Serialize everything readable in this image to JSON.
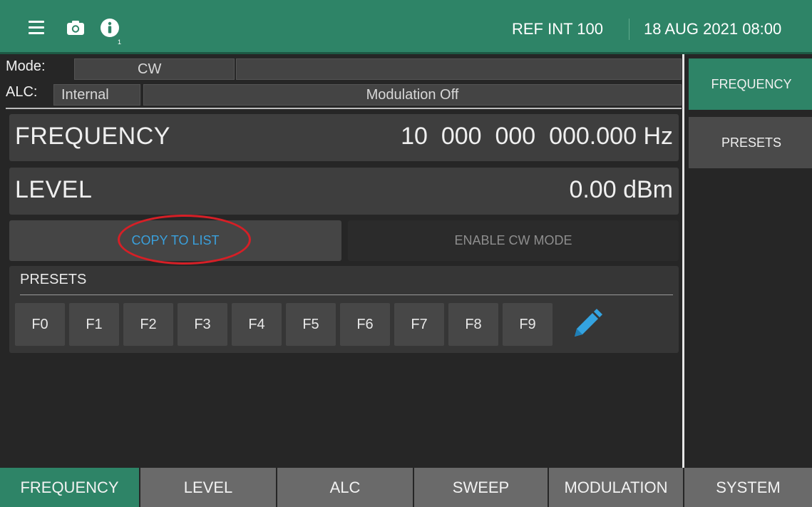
{
  "topbar": {
    "info_badge": "1",
    "reference": "REF INT 100",
    "datetime": "18 AUG 2021 08:00",
    "icons": [
      "menu-icon",
      "camera-icon",
      "info-icon"
    ],
    "accent_color": "#2e8467"
  },
  "status": {
    "mode_label": "Mode:",
    "mode_value": "CW",
    "alc_label": "ALC:",
    "alc_value": "Internal",
    "modulation": "Modulation Off"
  },
  "frequency": {
    "label": "FREQUENCY",
    "value": "10  000  000  000.000",
    "unit": "Hz"
  },
  "level": {
    "label": "LEVEL",
    "value": "0.00",
    "unit": "dBm"
  },
  "actions": {
    "copy_to_list": "COPY TO LIST",
    "enable_cw_mode": "ENABLE CW MODE"
  },
  "presets": {
    "title": "PRESETS",
    "items": [
      "F0",
      "F1",
      "F2",
      "F3",
      "F4",
      "F5",
      "F6",
      "F7",
      "F8",
      "F9"
    ],
    "edit_icon": "pencil-icon"
  },
  "side_menu": {
    "items": [
      "FREQUENCY",
      "PRESETS"
    ],
    "active": "FREQUENCY"
  },
  "tabs": {
    "items": [
      "FREQUENCY",
      "LEVEL",
      "ALC",
      "SWEEP",
      "MODULATION",
      "SYSTEM"
    ],
    "active": "FREQUENCY"
  },
  "highlight_color": "#d61f26"
}
